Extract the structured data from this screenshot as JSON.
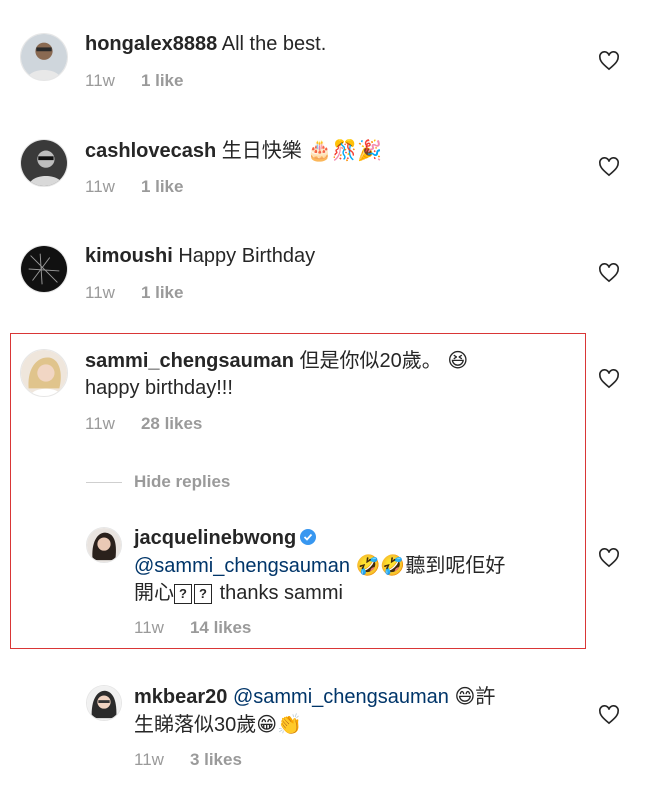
{
  "comments": [
    {
      "username": "hongalex8888",
      "text": "All the best.",
      "time": "11w",
      "likes": "1 like",
      "avatar_icon": "person-avatar-icon"
    },
    {
      "username": "cashlovecash",
      "text": "生日快樂",
      "emojis": "🎂🎊🎉",
      "time": "11w",
      "likes": "1 like"
    },
    {
      "username": "kimoushi",
      "text": "Happy Birthday",
      "time": "11w",
      "likes": "1 like"
    },
    {
      "username": "sammi_chengsauman",
      "text_line1": "但是你似20歲。",
      "emoji": "😆",
      "text_line2": "happy birthday!!!",
      "time": "11w",
      "likes": "28 likes"
    }
  ],
  "hide_replies": "Hide replies",
  "replies": [
    {
      "username": "jacquelinebwong",
      "mention": "@sammi_chengsauman",
      "emojis": "🤣🤣",
      "text_line1_rest": "聽到呢佢好",
      "text_line2_a": "開心",
      "text_line2_b": "thanks sammi",
      "unknown_glyph": "?",
      "time": "11w",
      "likes": "14 likes"
    },
    {
      "username": "mkbear20",
      "mention": "@sammi_chengsauman",
      "emoji1": "😄",
      "text_line1_rest": "許",
      "text_line2": "生睇落似30歲",
      "emojis2": "😁👏",
      "time": "11w",
      "likes": "3 likes"
    }
  ],
  "colors": {
    "username": "#262626",
    "mention": "#003569",
    "meta": "#9a9a9a",
    "highlight_border": "#d93636",
    "verified": "#3897f0"
  }
}
